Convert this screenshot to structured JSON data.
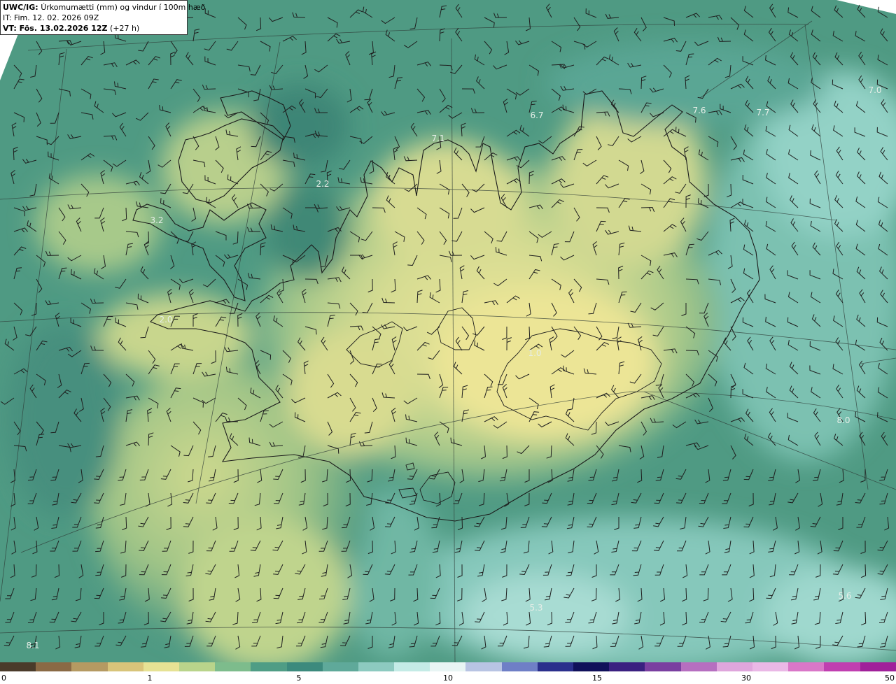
{
  "title": {
    "product": "UWC/IG:",
    "description": "Úrkomumætti (mm) og vindur í 100m hæð",
    "init_time": "IT: Fim. 12. 02. 2026 09Z",
    "valid_prefix": "VT: Fös. 13.02.2026 12Z",
    "valid_suffix": "(+27 h)"
  },
  "colors": {
    "land_background": "#4f9a83",
    "sea_teal": "#58a58f",
    "light_teal": "#8ecdc0",
    "yellow": "#dcde92",
    "dark": "#2c6e62",
    "coast_line": "#1a1a1a",
    "barb_color": "#1e1e1e"
  },
  "map_labels": [
    {
      "text": "6.7"
    },
    {
      "text": "7.6"
    },
    {
      "text": "7.7"
    },
    {
      "text": "7.0"
    },
    {
      "text": "7.1"
    },
    {
      "text": "2.2"
    },
    {
      "text": "3.2"
    },
    {
      "text": "2.0"
    },
    {
      "text": "1.0"
    },
    {
      "text": "8.0"
    },
    {
      "text": "5.3"
    },
    {
      "text": "5.6"
    },
    {
      "text": "8.1"
    }
  ],
  "colorbar": {
    "ticks": [
      "0",
      "1",
      "5",
      "10",
      "15",
      "30",
      "50"
    ],
    "segments": [
      "#4a3b2a",
      "#8a6a45",
      "#b59a62",
      "#d8c47a",
      "#e6e294",
      "#b9d48b",
      "#7dbc8c",
      "#4f9d85",
      "#3c8a7d",
      "#5fa99a",
      "#8dcac0",
      "#c4ebe6",
      "#e8f5f4",
      "#b8c4e3",
      "#6f7fc6",
      "#2a2f8c",
      "#10105a",
      "#3a2080",
      "#7a3fa0",
      "#b66fc0",
      "#dfa6dc",
      "#eab8e6",
      "#d977c8",
      "#c03fb0",
      "#a0209a"
    ]
  }
}
